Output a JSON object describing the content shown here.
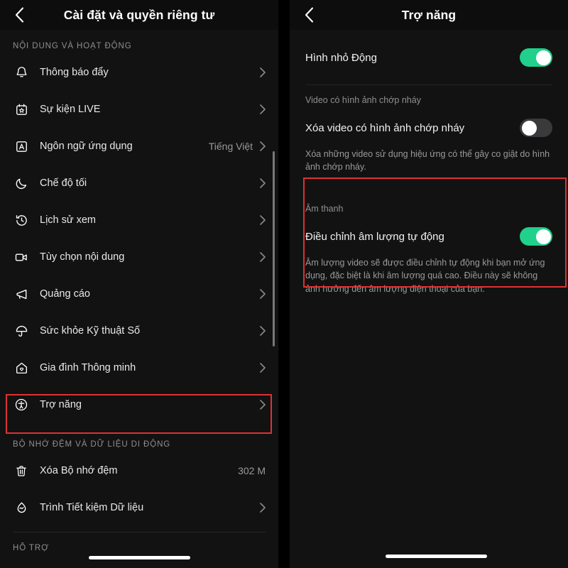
{
  "left": {
    "header": {
      "title": "Cài đặt và quyền riêng tư",
      "back_icon": "chevron-left-icon"
    },
    "sections": [
      {
        "label": "NỘI DUNG VÀ HOẠT ĐỘNG",
        "items": [
          {
            "icon": "bell-icon",
            "label": "Thông báo đẩy",
            "value": "",
            "chevron": true
          },
          {
            "icon": "calendar-star-icon",
            "label": "Sự kiện LIVE",
            "value": "",
            "chevron": true
          },
          {
            "icon": "letter-a-box-icon",
            "label": "Ngôn ngữ ứng dụng",
            "value": "Tiếng Việt",
            "chevron": true
          },
          {
            "icon": "moon-icon",
            "label": "Chế độ tối",
            "value": "",
            "chevron": true
          },
          {
            "icon": "clock-history-icon",
            "label": "Lịch sử xem",
            "value": "",
            "chevron": true
          },
          {
            "icon": "video-camera-icon",
            "label": "Tùy chọn nội dung",
            "value": "",
            "chevron": true
          },
          {
            "icon": "megaphone-icon",
            "label": "Quảng cáo",
            "value": "",
            "chevron": true
          },
          {
            "icon": "umbrella-icon",
            "label": "Sức khỏe Kỹ thuật Số",
            "value": "",
            "chevron": true
          },
          {
            "icon": "house-heart-icon",
            "label": "Gia đình Thông minh",
            "value": "",
            "chevron": true
          },
          {
            "icon": "accessibility-icon",
            "label": "Trợ năng",
            "value": "",
            "chevron": true,
            "highlighted": true
          }
        ]
      },
      {
        "label": "BỘ NHỚ ĐỆM VÀ DỮ LIỆU DI ĐỘNG",
        "items": [
          {
            "icon": "trash-icon",
            "label": "Xóa Bộ nhớ đệm",
            "value": "302 M",
            "chevron": false
          },
          {
            "icon": "data-saver-icon",
            "label": "Trình Tiết kiệm Dữ liệu",
            "value": "",
            "chevron": true
          }
        ]
      },
      {
        "label": "HỖ TRỢ",
        "items": []
      }
    ],
    "highlight_color": "#e03131",
    "scrollbar_visible": true
  },
  "right": {
    "header": {
      "title": "Trợ năng",
      "back_icon": "chevron-left-icon"
    },
    "rows": [
      {
        "label": "Hình nhỏ Động",
        "toggle": "on"
      }
    ],
    "flashing_group": {
      "label": "Video có hình ảnh chớp nháy",
      "row_label": "Xóa video có hình ảnh chớp nháy",
      "toggle": "off",
      "description": "Xóa những video sử dụng hiệu ứng có thể gây co giật do hình ảnh chớp nháy."
    },
    "sound_group": {
      "label": "Âm thanh",
      "row_label": "Điều chỉnh âm lượng tự động",
      "toggle": "on",
      "description": "Âm lượng video sẽ được điều chỉnh tự động khi bạn mở ứng dụng, đặc biệt là khi âm lượng quá cao. Điều này sẽ không ảnh hưởng đến âm lượng điện thoại của bạn.",
      "highlighted": true
    },
    "highlight_color": "#e03131"
  }
}
